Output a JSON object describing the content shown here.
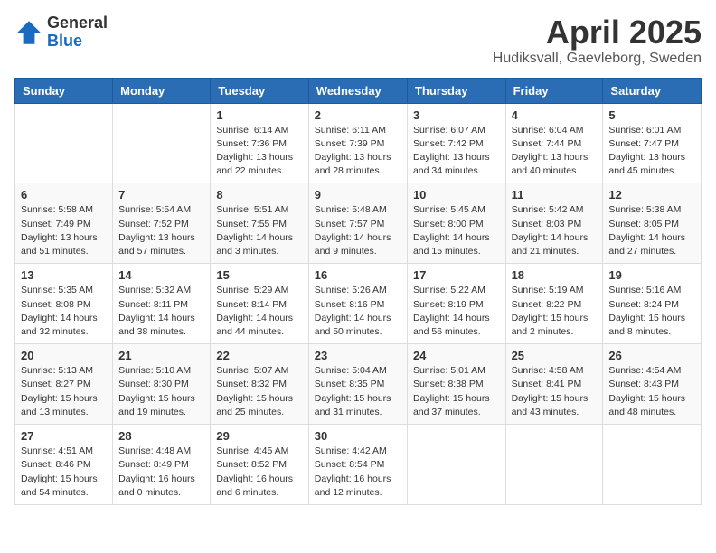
{
  "logo": {
    "general": "General",
    "blue": "Blue"
  },
  "title": {
    "month_year": "April 2025",
    "location": "Hudiksvall, Gaevleborg, Sweden"
  },
  "weekdays": [
    "Sunday",
    "Monday",
    "Tuesday",
    "Wednesday",
    "Thursday",
    "Friday",
    "Saturday"
  ],
  "weeks": [
    [
      {
        "day": "",
        "info": ""
      },
      {
        "day": "",
        "info": ""
      },
      {
        "day": "1",
        "info": "Sunrise: 6:14 AM\nSunset: 7:36 PM\nDaylight: 13 hours\nand 22 minutes."
      },
      {
        "day": "2",
        "info": "Sunrise: 6:11 AM\nSunset: 7:39 PM\nDaylight: 13 hours\nand 28 minutes."
      },
      {
        "day": "3",
        "info": "Sunrise: 6:07 AM\nSunset: 7:42 PM\nDaylight: 13 hours\nand 34 minutes."
      },
      {
        "day": "4",
        "info": "Sunrise: 6:04 AM\nSunset: 7:44 PM\nDaylight: 13 hours\nand 40 minutes."
      },
      {
        "day": "5",
        "info": "Sunrise: 6:01 AM\nSunset: 7:47 PM\nDaylight: 13 hours\nand 45 minutes."
      }
    ],
    [
      {
        "day": "6",
        "info": "Sunrise: 5:58 AM\nSunset: 7:49 PM\nDaylight: 13 hours\nand 51 minutes."
      },
      {
        "day": "7",
        "info": "Sunrise: 5:54 AM\nSunset: 7:52 PM\nDaylight: 13 hours\nand 57 minutes."
      },
      {
        "day": "8",
        "info": "Sunrise: 5:51 AM\nSunset: 7:55 PM\nDaylight: 14 hours\nand 3 minutes."
      },
      {
        "day": "9",
        "info": "Sunrise: 5:48 AM\nSunset: 7:57 PM\nDaylight: 14 hours\nand 9 minutes."
      },
      {
        "day": "10",
        "info": "Sunrise: 5:45 AM\nSunset: 8:00 PM\nDaylight: 14 hours\nand 15 minutes."
      },
      {
        "day": "11",
        "info": "Sunrise: 5:42 AM\nSunset: 8:03 PM\nDaylight: 14 hours\nand 21 minutes."
      },
      {
        "day": "12",
        "info": "Sunrise: 5:38 AM\nSunset: 8:05 PM\nDaylight: 14 hours\nand 27 minutes."
      }
    ],
    [
      {
        "day": "13",
        "info": "Sunrise: 5:35 AM\nSunset: 8:08 PM\nDaylight: 14 hours\nand 32 minutes."
      },
      {
        "day": "14",
        "info": "Sunrise: 5:32 AM\nSunset: 8:11 PM\nDaylight: 14 hours\nand 38 minutes."
      },
      {
        "day": "15",
        "info": "Sunrise: 5:29 AM\nSunset: 8:14 PM\nDaylight: 14 hours\nand 44 minutes."
      },
      {
        "day": "16",
        "info": "Sunrise: 5:26 AM\nSunset: 8:16 PM\nDaylight: 14 hours\nand 50 minutes."
      },
      {
        "day": "17",
        "info": "Sunrise: 5:22 AM\nSunset: 8:19 PM\nDaylight: 14 hours\nand 56 minutes."
      },
      {
        "day": "18",
        "info": "Sunrise: 5:19 AM\nSunset: 8:22 PM\nDaylight: 15 hours\nand 2 minutes."
      },
      {
        "day": "19",
        "info": "Sunrise: 5:16 AM\nSunset: 8:24 PM\nDaylight: 15 hours\nand 8 minutes."
      }
    ],
    [
      {
        "day": "20",
        "info": "Sunrise: 5:13 AM\nSunset: 8:27 PM\nDaylight: 15 hours\nand 13 minutes."
      },
      {
        "day": "21",
        "info": "Sunrise: 5:10 AM\nSunset: 8:30 PM\nDaylight: 15 hours\nand 19 minutes."
      },
      {
        "day": "22",
        "info": "Sunrise: 5:07 AM\nSunset: 8:32 PM\nDaylight: 15 hours\nand 25 minutes."
      },
      {
        "day": "23",
        "info": "Sunrise: 5:04 AM\nSunset: 8:35 PM\nDaylight: 15 hours\nand 31 minutes."
      },
      {
        "day": "24",
        "info": "Sunrise: 5:01 AM\nSunset: 8:38 PM\nDaylight: 15 hours\nand 37 minutes."
      },
      {
        "day": "25",
        "info": "Sunrise: 4:58 AM\nSunset: 8:41 PM\nDaylight: 15 hours\nand 43 minutes."
      },
      {
        "day": "26",
        "info": "Sunrise: 4:54 AM\nSunset: 8:43 PM\nDaylight: 15 hours\nand 48 minutes."
      }
    ],
    [
      {
        "day": "27",
        "info": "Sunrise: 4:51 AM\nSunset: 8:46 PM\nDaylight: 15 hours\nand 54 minutes."
      },
      {
        "day": "28",
        "info": "Sunrise: 4:48 AM\nSunset: 8:49 PM\nDaylight: 16 hours\nand 0 minutes."
      },
      {
        "day": "29",
        "info": "Sunrise: 4:45 AM\nSunset: 8:52 PM\nDaylight: 16 hours\nand 6 minutes."
      },
      {
        "day": "30",
        "info": "Sunrise: 4:42 AM\nSunset: 8:54 PM\nDaylight: 16 hours\nand 12 minutes."
      },
      {
        "day": "",
        "info": ""
      },
      {
        "day": "",
        "info": ""
      },
      {
        "day": "",
        "info": ""
      }
    ]
  ]
}
